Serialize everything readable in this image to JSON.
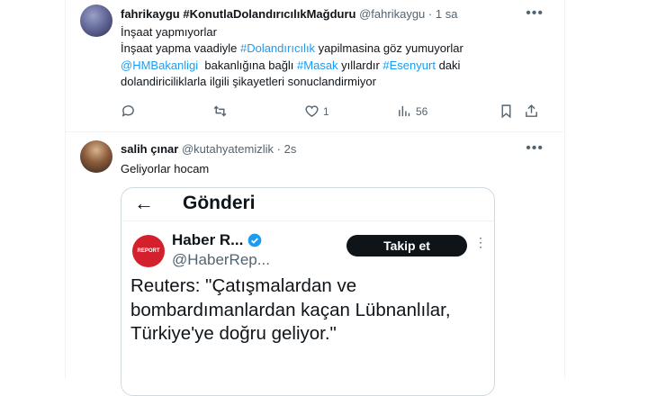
{
  "tweet1": {
    "display_name": "fahrikaygu #KonutlaDolandırıcılıkMağduru",
    "handle": "@fahrikaygu",
    "separator": "·",
    "time": "1 sa",
    "line1": "İnşaat yapmıyorlar",
    "line2_pre": "İnşaat yapma vaadiyle ",
    "line2_tag": "#Dolandırıcılık",
    "line2_post": " yapilmasina göz yumuyorlar",
    "line3_mention": "@HMBakanligi",
    "line3_mid": "  bakanlığına bağlı ",
    "line3_tag1": "#Masak",
    "line3_mid2": " yıllardır ",
    "line3_tag2": "#Esenyurt",
    "line3_post": " daki",
    "line4": "dolandiriciliklarla ilgili şikayetleri sonuclandirmiyor",
    "like_count": "1",
    "view_count": "56"
  },
  "tweet2": {
    "display_name": "salih çınar",
    "handle": "@kutahyatemizlik",
    "separator": "·",
    "time": "2s",
    "text": "Geliyorlar hocam",
    "embed": {
      "title": "Gönderi",
      "logo_text": "REPORT",
      "name": "Haber R...",
      "handle": "@HaberRep...",
      "follow_label": "Takip et",
      "text": "Reuters: \"Çatışmalardan ve bombardımanlardan kaçan Lübnanlılar, Türkiye'ye doğru geliyor.\""
    }
  },
  "colors": {
    "link": "#1d9bf0",
    "muted": "#536471",
    "verified": "#1d9bf0"
  },
  "icons": [
    "more-icon",
    "reply-icon",
    "retweet-icon",
    "like-icon",
    "views-icon",
    "bookmark-icon",
    "share-icon",
    "back-arrow-icon",
    "verified-icon"
  ]
}
